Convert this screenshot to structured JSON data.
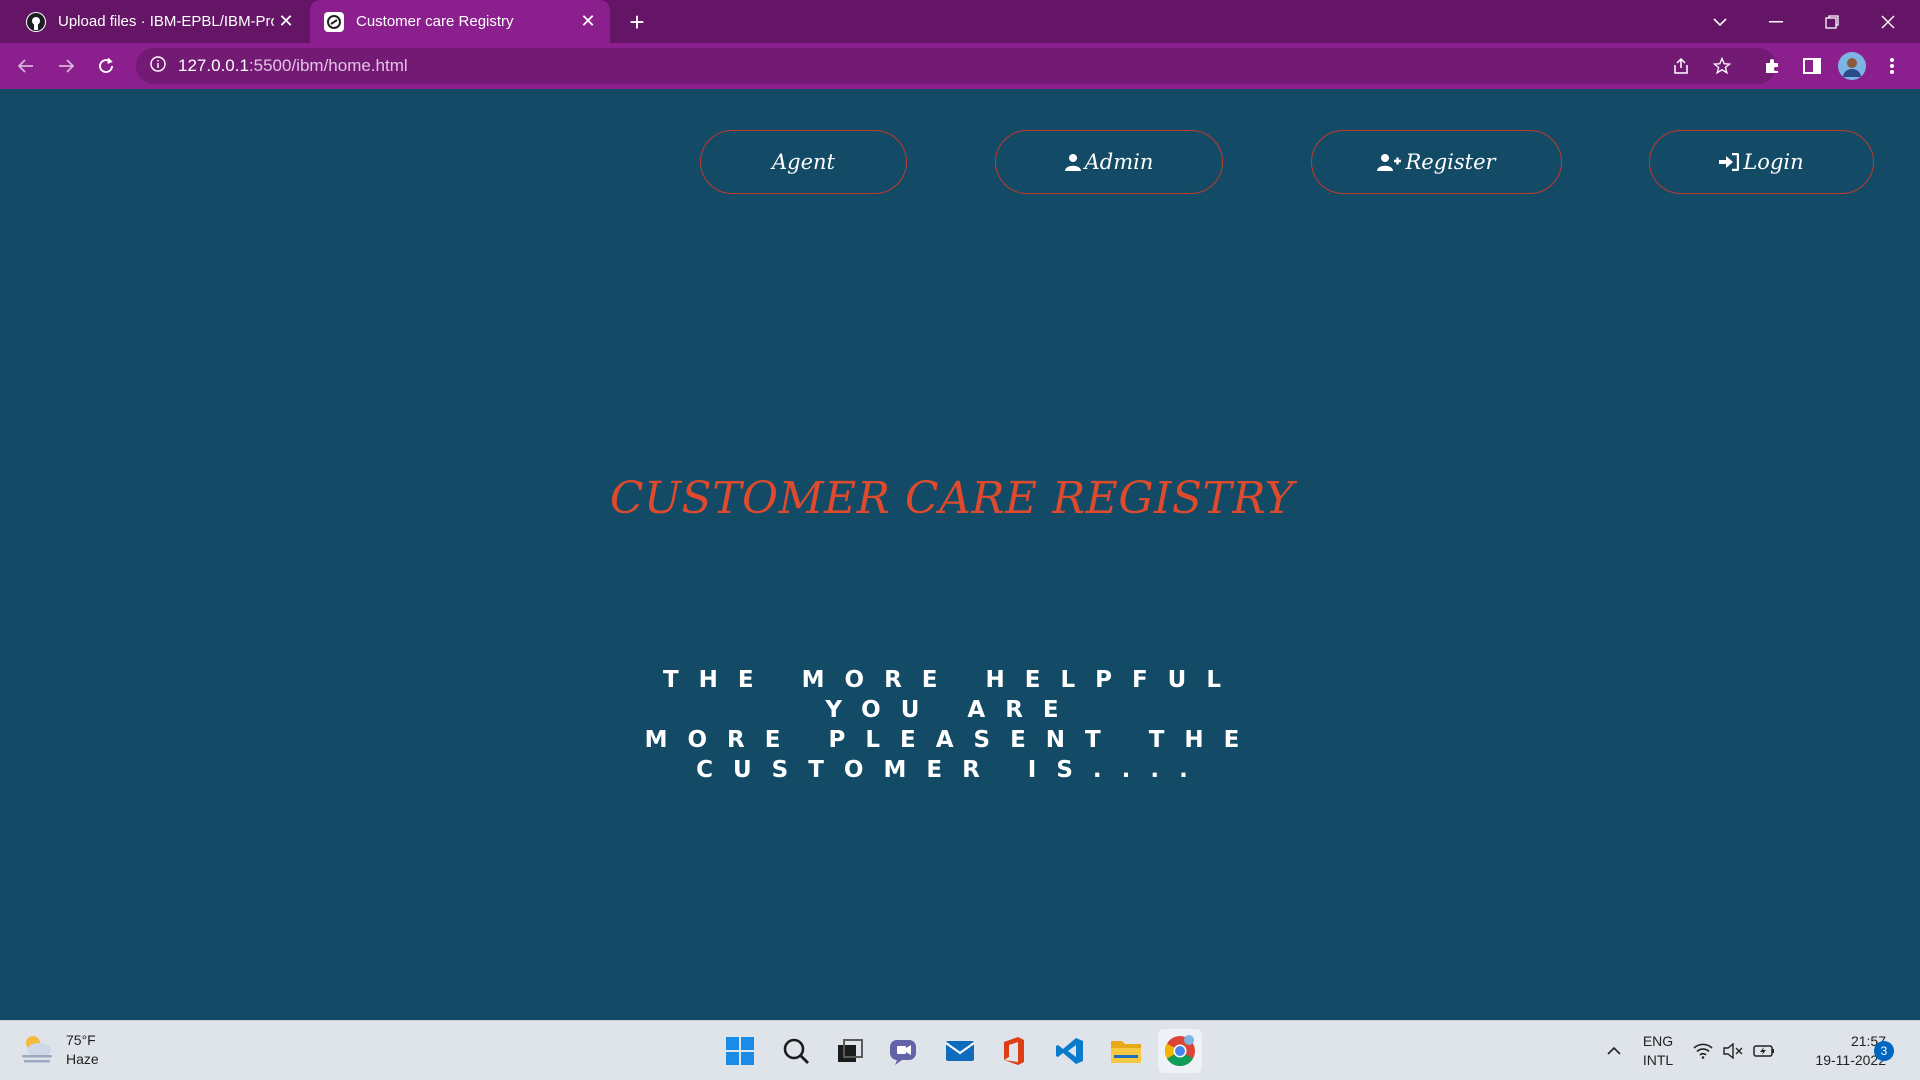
{
  "browser": {
    "tabs": [
      {
        "title": "Upload files · IBM-EPBL/IBM-Proj",
        "active": false,
        "icon": "github-icon"
      },
      {
        "title": "Customer care Registry",
        "active": true,
        "icon": "site-favicon-icon"
      }
    ],
    "address": {
      "host": "127.0.0.1",
      "path": ":5500/ibm/home.html"
    }
  },
  "page": {
    "nav": {
      "agent": "Agent",
      "admin": "Admin",
      "register": "Register",
      "login": "Login"
    },
    "headline": "CUSTOMER CARE REGISTRY",
    "tagline": [
      "THE MORE HELPFUL YOU ARE",
      "MORE PLEASENT THE CUSTOMER IS...."
    ]
  },
  "taskbar": {
    "weather": {
      "temp": "75°F",
      "condition": "Haze"
    },
    "lang": {
      "line1": "ENG",
      "line2": "INTL"
    },
    "clock": {
      "time": "21:57",
      "date": "19-11-2022"
    },
    "notifications": "3"
  },
  "colors": {
    "page_bg": "#134a66",
    "headline": "#e04a2c",
    "pill_border": "#c1392b",
    "chrome_tabbar": "#651566",
    "chrome_toolbar": "#8a1f8d"
  }
}
